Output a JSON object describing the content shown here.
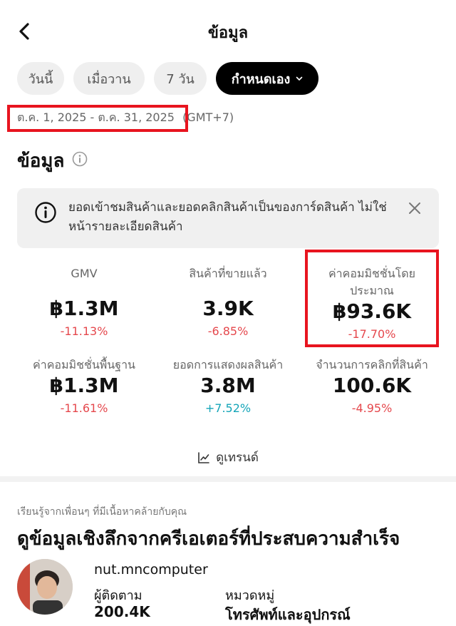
{
  "header": {
    "title": "ข้อมูล"
  },
  "filters": {
    "chips": [
      "วันนี้",
      "เมื่อวาน",
      "7 วัน"
    ],
    "active_chip": "กำหนดเอง"
  },
  "date_range": {
    "range": "ต.ค. 1, 2025 - ต.ค. 31, 2025",
    "timezone": "(GMT+7)"
  },
  "section": {
    "title": "ข้อมูล"
  },
  "notice": {
    "text": "ยอดเข้าชมสินค้าและยอดคลิกสินค้าเป็นของการ์ดสินค้า ไม่ใช่หน้ารายละเอียดสินค้า"
  },
  "metrics": [
    {
      "label": "GMV",
      "value": "฿1.3M",
      "change": "-11.13%"
    },
    {
      "label": "สินค้าที่ขายแล้ว",
      "value": "3.9K",
      "change": "-6.85%"
    },
    {
      "label": "ค่าคอมมิชชั่นโดยประมาณ",
      "value": "฿93.6K",
      "change": "-17.70%"
    },
    {
      "label": "ค่าคอมมิชชั่นพื้นฐาน",
      "value": "฿1.3M",
      "change": "-11.61%"
    },
    {
      "label": "ยอดการแสดงผลสินค้า",
      "value": "3.8M",
      "change": "+7.52%"
    },
    {
      "label": "จำนวนการคลิกที่สินค้า",
      "value": "100.6K",
      "change": "-4.95%"
    }
  ],
  "trend": {
    "label": "ดูเทรนด์"
  },
  "learn": {
    "subtitle": "เรียนรู้จากเพื่อนๆ ที่มีเนื้อหาคล้ายกับคุณ",
    "title": "ดูข้อมูลเชิงลึกจากครีเอเตอร์ที่ประสบความสำเร็จ"
  },
  "creator": {
    "name": "nut.mncomputer",
    "followers_label": "ผู้ติดตาม",
    "followers_value": "200.4K",
    "category_label": "หมวดหมู่",
    "category_value": "โทรศัพท์และอุปกรณ์"
  },
  "colors": {
    "negative": "#e5484d",
    "positive": "#14a5b8",
    "highlight": "#e8141f"
  }
}
